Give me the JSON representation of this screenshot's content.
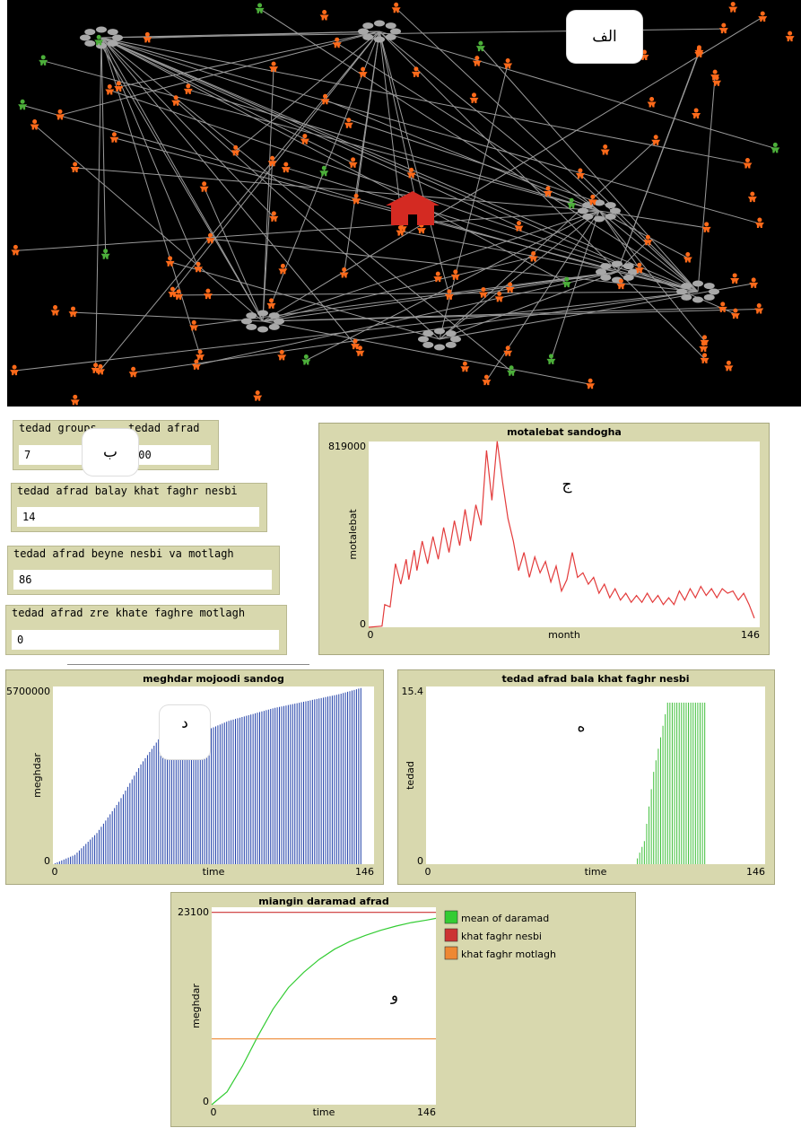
{
  "callouts": {
    "a": "الف",
    "b": "ب",
    "c": "ج",
    "d": "د",
    "e": "ه",
    "f": "و"
  },
  "colors": {
    "orange": "#ff6a1a",
    "green": "#4caf3a",
    "gray": "#9a9a9a",
    "house": "#d42a22",
    "panel": "#d8d8ae"
  },
  "icons": {
    "person": "person-icon",
    "house": "house-icon",
    "group": "group-node-icon"
  },
  "monitors": {
    "groups": {
      "label": "tedad groups",
      "value": "7"
    },
    "people": {
      "label": "tedad afrad",
      "value": "100"
    },
    "above_relative": {
      "label": "tedad afrad balay khat faghr nesbi",
      "value": "14"
    },
    "between": {
      "label": "tedad afrad beyne nesbi va motlagh",
      "value": "86"
    },
    "below_absolute": {
      "label": "tedad afrad zre khate faghre motlagh",
      "value": "0"
    }
  },
  "chart_data": [
    {
      "type": "line",
      "title": "motalebat sandogha",
      "xlabel": "month",
      "ylabel": "motalebat",
      "xlim": [
        0,
        146
      ],
      "ylim": [
        0,
        819000
      ],
      "x_tick_labels": [
        "0",
        "146"
      ],
      "y_tick_labels": [
        "0",
        "819000"
      ],
      "series": [
        {
          "color": "#e33b3b",
          "x": [
            0,
            5,
            6,
            8,
            10,
            12,
            14,
            15,
            17,
            18,
            20,
            22,
            24,
            26,
            28,
            30,
            32,
            34,
            36,
            38,
            40,
            42,
            44,
            46,
            48,
            50,
            52,
            54,
            56,
            58,
            60,
            62,
            64,
            66,
            68,
            70,
            72,
            74,
            76,
            78,
            80,
            82,
            84,
            86,
            88,
            90,
            92,
            94,
            96,
            98,
            100,
            102,
            104,
            106,
            108,
            110,
            112,
            114,
            116,
            118,
            120,
            122,
            124,
            126,
            128,
            130,
            132,
            134,
            136,
            138,
            140,
            142,
            144
          ],
          "y": [
            0,
            5000,
            100000,
            90000,
            280000,
            190000,
            300000,
            210000,
            340000,
            250000,
            380000,
            280000,
            400000,
            300000,
            440000,
            330000,
            470000,
            360000,
            520000,
            380000,
            540000,
            450000,
            780000,
            560000,
            820000,
            640000,
            480000,
            380000,
            250000,
            330000,
            220000,
            310000,
            240000,
            290000,
            200000,
            270000,
            160000,
            210000,
            330000,
            220000,
            240000,
            190000,
            220000,
            150000,
            190000,
            130000,
            170000,
            120000,
            150000,
            110000,
            140000,
            110000,
            150000,
            110000,
            140000,
            100000,
            130000,
            100000,
            160000,
            120000,
            170000,
            130000,
            180000,
            140000,
            170000,
            130000,
            170000,
            150000,
            160000,
            120000,
            150000,
            100000,
            40000
          ]
        }
      ]
    },
    {
      "type": "bar",
      "title": "meghdar mojoodi sandog",
      "xlabel": "time",
      "ylabel": "meghdar",
      "xlim": [
        0,
        146
      ],
      "ylim": [
        0,
        5700000
      ],
      "x_tick_labels": [
        "0",
        "146"
      ],
      "y_tick_labels": [
        "0",
        "5700000"
      ],
      "series": [
        {
          "color": "#1f3fa8",
          "x": [
            0,
            10,
            20,
            30,
            40,
            50,
            60,
            70,
            80,
            90,
            100,
            110,
            120,
            130,
            140
          ],
          "y": [
            0,
            300000,
            1000000,
            2000000,
            3200000,
            4200000,
            4500000,
            4300000,
            4600000,
            4800000,
            5000000,
            5150000,
            5300000,
            5450000,
            5650000
          ]
        }
      ]
    },
    {
      "type": "bar",
      "title": "tedad afrad bala khat faghr nesbi",
      "xlabel": "time",
      "ylabel": "tedad",
      "xlim": [
        0,
        146
      ],
      "ylim": [
        0,
        15.4
      ],
      "x_tick_labels": [
        "0",
        "146"
      ],
      "y_tick_labels": [
        "0",
        "15.4"
      ],
      "series": [
        {
          "color": "#3fbf3a",
          "x": [
            0,
            90,
            94,
            96,
            98,
            100,
            102,
            104,
            106,
            120
          ],
          "y": [
            0,
            0,
            2,
            5,
            8,
            10,
            12,
            14,
            14,
            14
          ]
        }
      ]
    },
    {
      "type": "line",
      "title": "miangin daramad afrad",
      "xlabel": "time",
      "ylabel": "meghdar",
      "xlim": [
        0,
        146
      ],
      "ylim": [
        0,
        23100
      ],
      "x_tick_labels": [
        "0",
        "146"
      ],
      "y_tick_labels": [
        "0",
        "23100"
      ],
      "legend": "right",
      "series": [
        {
          "name": "mean of daramad",
          "color": "#33cc33",
          "x": [
            0,
            10,
            20,
            30,
            40,
            50,
            60,
            70,
            80,
            90,
            100,
            110,
            120,
            130,
            140,
            146
          ],
          "y": [
            0,
            1500,
            4500,
            8000,
            11200,
            13700,
            15500,
            17000,
            18200,
            19100,
            19800,
            20400,
            20900,
            21300,
            21600,
            21800
          ]
        },
        {
          "name": "khat faghr nesbi",
          "color": "#cc3333",
          "x": [
            0,
            146
          ],
          "y": [
            22500,
            22500
          ]
        },
        {
          "name": "khat faghr motlagh",
          "color": "#ee8833",
          "x": [
            0,
            96,
            146
          ],
          "y": [
            7700,
            7700,
            7700
          ]
        }
      ]
    }
  ]
}
